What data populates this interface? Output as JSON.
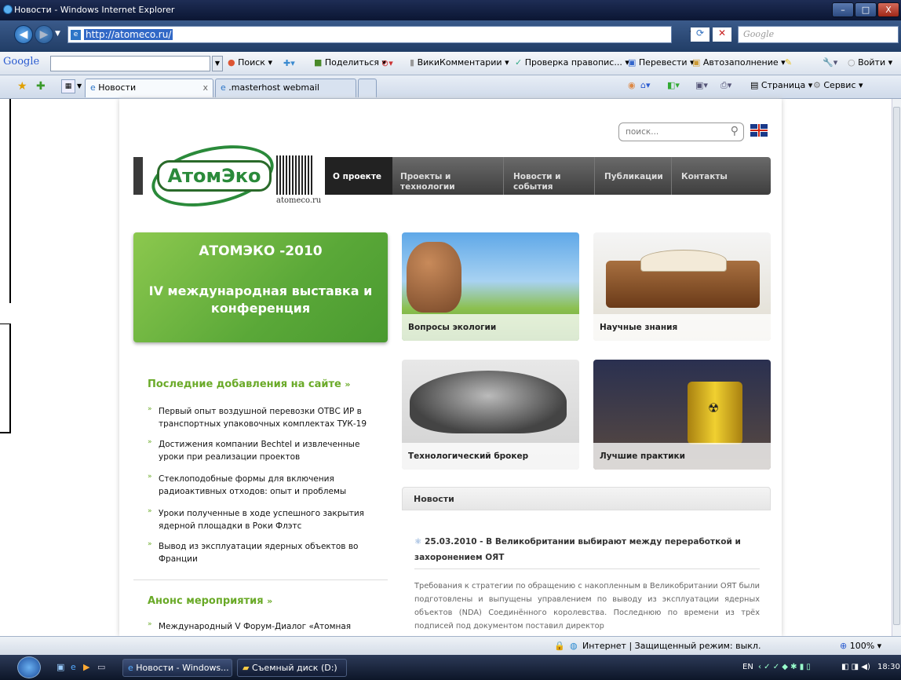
{
  "window": {
    "title": "Новости - Windows Internet Explorer",
    "min": "–",
    "max": "□",
    "close": "X"
  },
  "address": {
    "url": "http://atomeco.ru/",
    "search_placeholder": "Google"
  },
  "google_bar": {
    "logo": "Google",
    "items": [
      "Поиск",
      "Поделиться",
      "ВикиКомментарии",
      "Проверка правопис...",
      "Перевести",
      "Автозаполнение",
      "Войти"
    ]
  },
  "tabs": [
    {
      "label": "Новости",
      "close": "x"
    },
    {
      "label": ".masterhost webmail"
    }
  ],
  "cmd_bar": {
    "page": "Страница",
    "service": "Сервис"
  },
  "site": {
    "search_placeholder": "поиск...",
    "logo_text": "АтомЭко",
    "logo_domain": "atomeco.ru",
    "menu": [
      "О проекте",
      "Проекты и технологии",
      "Новости и события",
      "Публикации",
      "Контакты"
    ],
    "banner": {
      "title": "АТОМЭКО -2010",
      "subtitle": "IV международная выставка и конференция"
    },
    "tiles": [
      "Вопросы экологии",
      "Научные знания",
      "Технологический брокер",
      "Лучшие практики"
    ],
    "latest": {
      "heading": "Последние добавления на сайте",
      "items": [
        "Первый опыт воздушной перевозки ОТВС ИР в транспортных упаковочных комплектах ТУК-19",
        "Достижения компании Bechtel и извлеченные уроки при реализации проектов",
        "Стеклоподобные формы для включения радиоактивных отходов: опыт и проблемы",
        "Уроки полученные в ходе успешного закрытия ядерной площадки в Роки Флэтс",
        "Вывод из эксплуатации ядерных объектов во Франции"
      ]
    },
    "events": {
      "heading": "Анонс мероприятия",
      "items": [
        "Международный V Форум-Диалог «Атомная энергия,"
      ]
    },
    "news": {
      "heading": "Новости",
      "date_title": "25.03.2010 - В Великобритании выбирают между переработкой и захоронением ОЯТ",
      "body": "Требования к стратегии по обращению с накопленным в Великобритании ОЯТ были подготовлены и выпущены управлением по выводу из эксплуатации ядерных объектов (NDA) Соединённого королевства. Последнюю по времени из трёх подписей под документом поставил директор"
    }
  },
  "status": {
    "zone": "Интернет | Защищенный режим: выкл.",
    "zoom": "100%"
  },
  "taskbar": {
    "buttons": [
      "Новости - Windows...",
      "Съемный диск (D:)"
    ],
    "lang": "EN",
    "time": "18:30"
  }
}
